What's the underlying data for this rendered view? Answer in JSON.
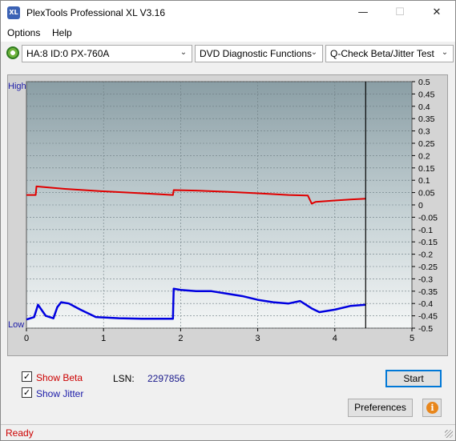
{
  "window": {
    "title": "PlexTools Professional XL V3.16",
    "app_icon_text": "XL"
  },
  "menu": {
    "options": "Options",
    "help": "Help"
  },
  "toolbar": {
    "drive": "HA:8 ID:0  PX-760A",
    "function": "DVD Diagnostic Functions",
    "test": "Q-Check Beta/Jitter Test"
  },
  "chart_data": {
    "type": "line",
    "left_axis_labels": {
      "high": "High",
      "low": "Low"
    },
    "x_ticks": [
      "0",
      "1",
      "2",
      "3",
      "4",
      "5"
    ],
    "xlim": [
      0,
      5
    ],
    "y_right_ticks": [
      "0.5",
      "0.45",
      "0.4",
      "0.35",
      "0.3",
      "0.25",
      "0.2",
      "0.15",
      "0.1",
      "0.05",
      "0",
      "-0.05",
      "-0.1",
      "-0.15",
      "-0.2",
      "-0.25",
      "-0.3",
      "-0.35",
      "-0.4",
      "-0.45",
      "-0.5"
    ],
    "ylim": [
      -0.5,
      0.5
    ],
    "grid": true,
    "end_marker_x": 4.4,
    "series": [
      {
        "color": "#e00000",
        "x": [
          0.0,
          0.12,
          0.13,
          0.2,
          0.5,
          1.0,
          1.5,
          1.9,
          1.91,
          2.2,
          2.6,
          3.0,
          3.4,
          3.65,
          3.7,
          3.75,
          4.0,
          4.2,
          4.4
        ],
        "y": [
          0.04,
          0.04,
          0.075,
          0.073,
          0.065,
          0.055,
          0.047,
          0.04,
          0.06,
          0.058,
          0.053,
          0.047,
          0.04,
          0.038,
          0.005,
          0.012,
          0.018,
          0.022,
          0.025
        ]
      },
      {
        "color": "#0000e0",
        "x": [
          0.0,
          0.1,
          0.15,
          0.25,
          0.35,
          0.4,
          0.45,
          0.55,
          0.7,
          0.9,
          1.2,
          1.5,
          1.9,
          1.91,
          2.0,
          2.2,
          2.4,
          2.6,
          2.8,
          3.0,
          3.2,
          3.4,
          3.55,
          3.7,
          3.8,
          4.0,
          4.2,
          4.4
        ],
        "y": [
          -0.465,
          -0.455,
          -0.405,
          -0.45,
          -0.46,
          -0.415,
          -0.395,
          -0.4,
          -0.425,
          -0.455,
          -0.46,
          -0.462,
          -0.462,
          -0.34,
          -0.345,
          -0.35,
          -0.35,
          -0.36,
          -0.37,
          -0.385,
          -0.395,
          -0.4,
          -0.39,
          -0.42,
          -0.435,
          -0.425,
          -0.41,
          -0.405
        ]
      }
    ]
  },
  "options": {
    "show_beta_label": "Show Beta",
    "show_beta_checked": true,
    "show_jitter_label": "Show Jitter",
    "show_jitter_checked": true,
    "lsn_label": "LSN:",
    "lsn_value": "2297856"
  },
  "buttons": {
    "start": "Start",
    "preferences": "Preferences",
    "info": "i"
  },
  "status": {
    "text": "Ready"
  },
  "colors": {
    "beta": "#e00000",
    "jitter": "#0000e0",
    "status": "#cc0000"
  }
}
